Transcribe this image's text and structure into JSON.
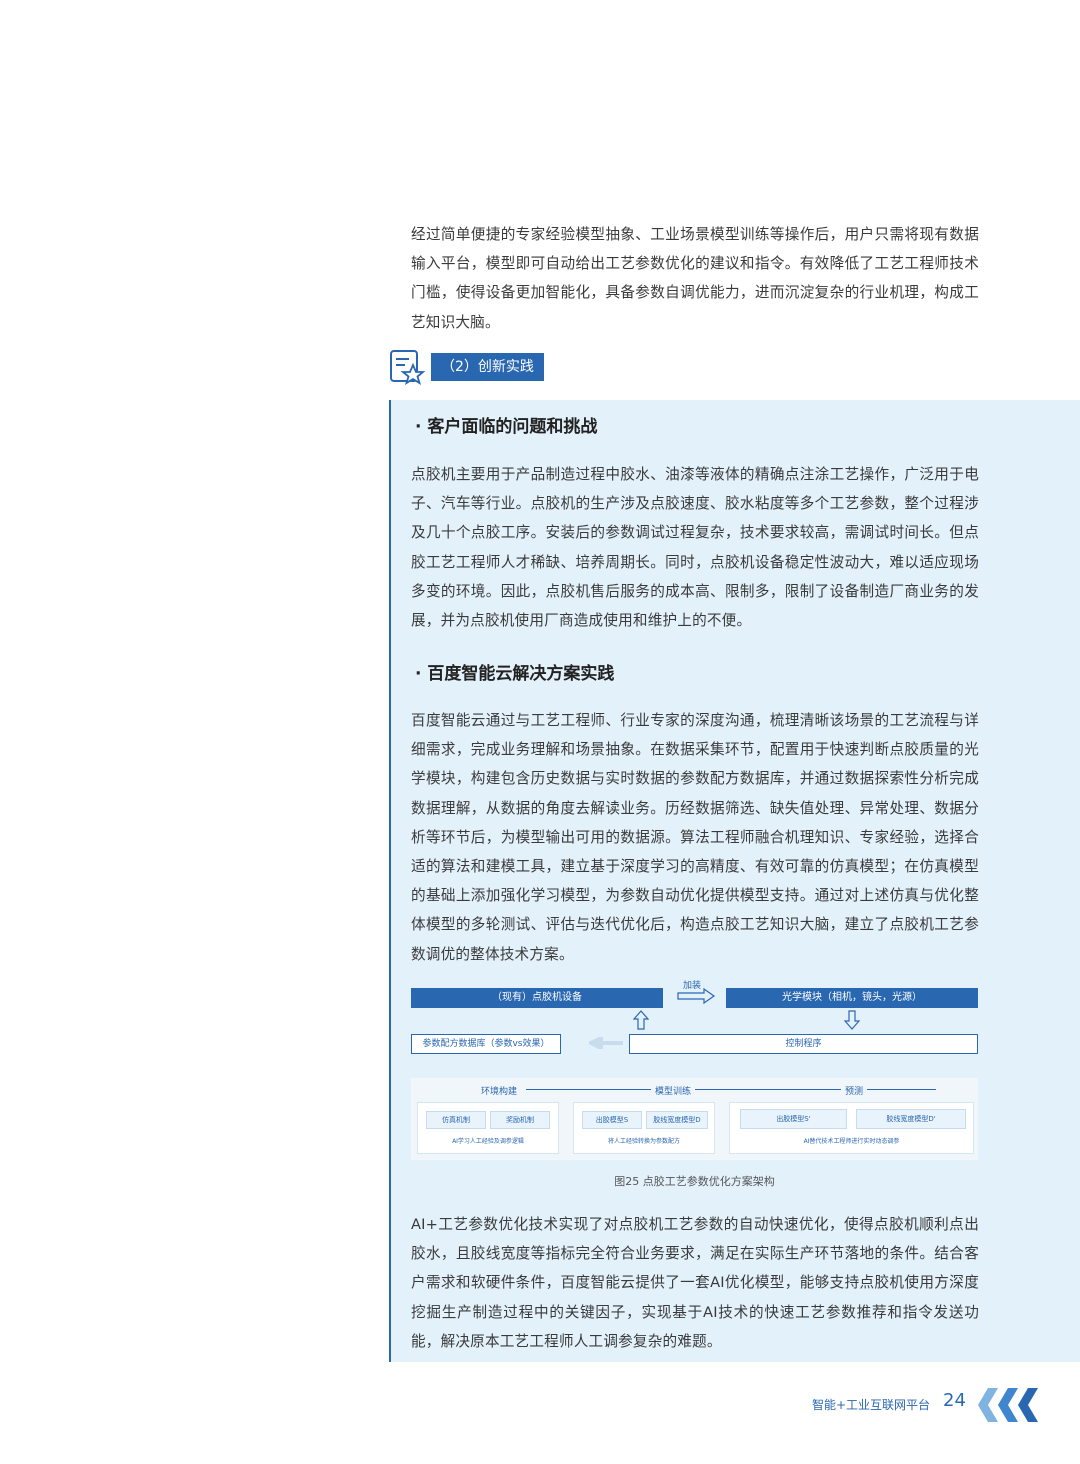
{
  "intro_paragraph": "经过简单便捷的专家经验模型抽象、工业场景模型训练等操作后，用户只需将现有数据输入平台，模型即可自动给出工艺参数优化的建议和指令。有效降低了工艺工程师技术门槛，使得设备更加智能化，具备参数自调优能力，进而沉淀复杂的行业机理，构成工艺知识大脑。",
  "section": {
    "icon": "star-document-icon",
    "label": "（2）创新实践"
  },
  "subsection1": {
    "title": "· 客户面临的问题和挑战",
    "body": "点胶机主要用于产品制造过程中胶水、油漆等液体的精确点注涂工艺操作，广泛用于电子、汽车等行业。点胶机的生产涉及点胶速度、胶水粘度等多个工艺参数，整个过程涉及几十个点胶工序。安装后的参数调试过程复杂，技术要求较高，需调试时间长。但点胶工艺工程师人才稀缺、培养周期长。同时，点胶机设备稳定性波动大，难以适应现场多变的环境。因此，点胶机售后服务的成本高、限制多，限制了设备制造厂商业务的发展，并为点胶机使用厂商造成使用和维护上的不便。"
  },
  "subsection2": {
    "title": "· 百度智能云解决方案实践",
    "body": "百度智能云通过与工艺工程师、行业专家的深度沟通，梳理清晰该场景的工艺流程与详细需求，完成业务理解和场景抽象。在数据采集环节，配置用于快速判断点胶质量的光学模块，构建包含历史数据与实时数据的参数配方数据库，并通过数据探索性分析完成数据理解，从数据的角度去解读业务。历经数据筛选、缺失值处理、异常处理、数据分析等环节后，为模型输出可用的数据源。算法工程师融合机理知识、专家经验，选择合适的算法和建模工具，建立基于深度学习的高精度、有效可靠的仿真模型；在仿真模型的基础上添加强化学习模型，为参数自动优化提供模型支持。通过对上述仿真与优化整体模型的多轮测试、评估与迭代优化后，构造点胶工艺知识大脑，建立了点胶机工艺参数调优的整体技术方案。"
  },
  "diagram": {
    "existing_device": "（现有）点胶机设备",
    "add_label": "加装",
    "optical_module": "光学模块（相机，镜头，光源）",
    "param_db": "参数配方数据库（参数vs效果）",
    "control_program": "控制程序",
    "stage1": "环境构建",
    "stage2": "模型训练",
    "stage3": "预测",
    "sim_mech": "仿真机制",
    "reward_mech": "奖励机制",
    "glue_model_s": "出胶模型S",
    "line_width_model_d": "胶线宽度模型D",
    "glue_model_s2": "出胶模型S'",
    "line_width_model_d2": "胶线宽度模型D'",
    "note1": "AI学习人工经验及调参逻辑",
    "note2": "将人工经验转换为参数配方",
    "note3": "AI替代技术工程师进行实时动态调参"
  },
  "figure_caption": "图25 点胶工艺参数优化方案架构",
  "closing_paragraph": "AI+工艺参数优化技术实现了对点胶机工艺参数的自动快速优化，使得点胶机顺利点出胶水，且胶线宽度等指标完全符合业务要求，满足在实际生产环节落地的条件。结合客户需求和软硬件条件，百度智能云提供了一套AI优化模型，能够支持点胶机使用方深度挖掘生产制造过程中的关键因子，实现基于AI技术的快速工艺参数推荐和指令发送功能，解决原本工艺工程师人工调参复杂的难题。",
  "footer": {
    "title": "智能+工业互联网平台",
    "page_number": "24",
    "decor_icon": "chevrons-left-icon"
  }
}
